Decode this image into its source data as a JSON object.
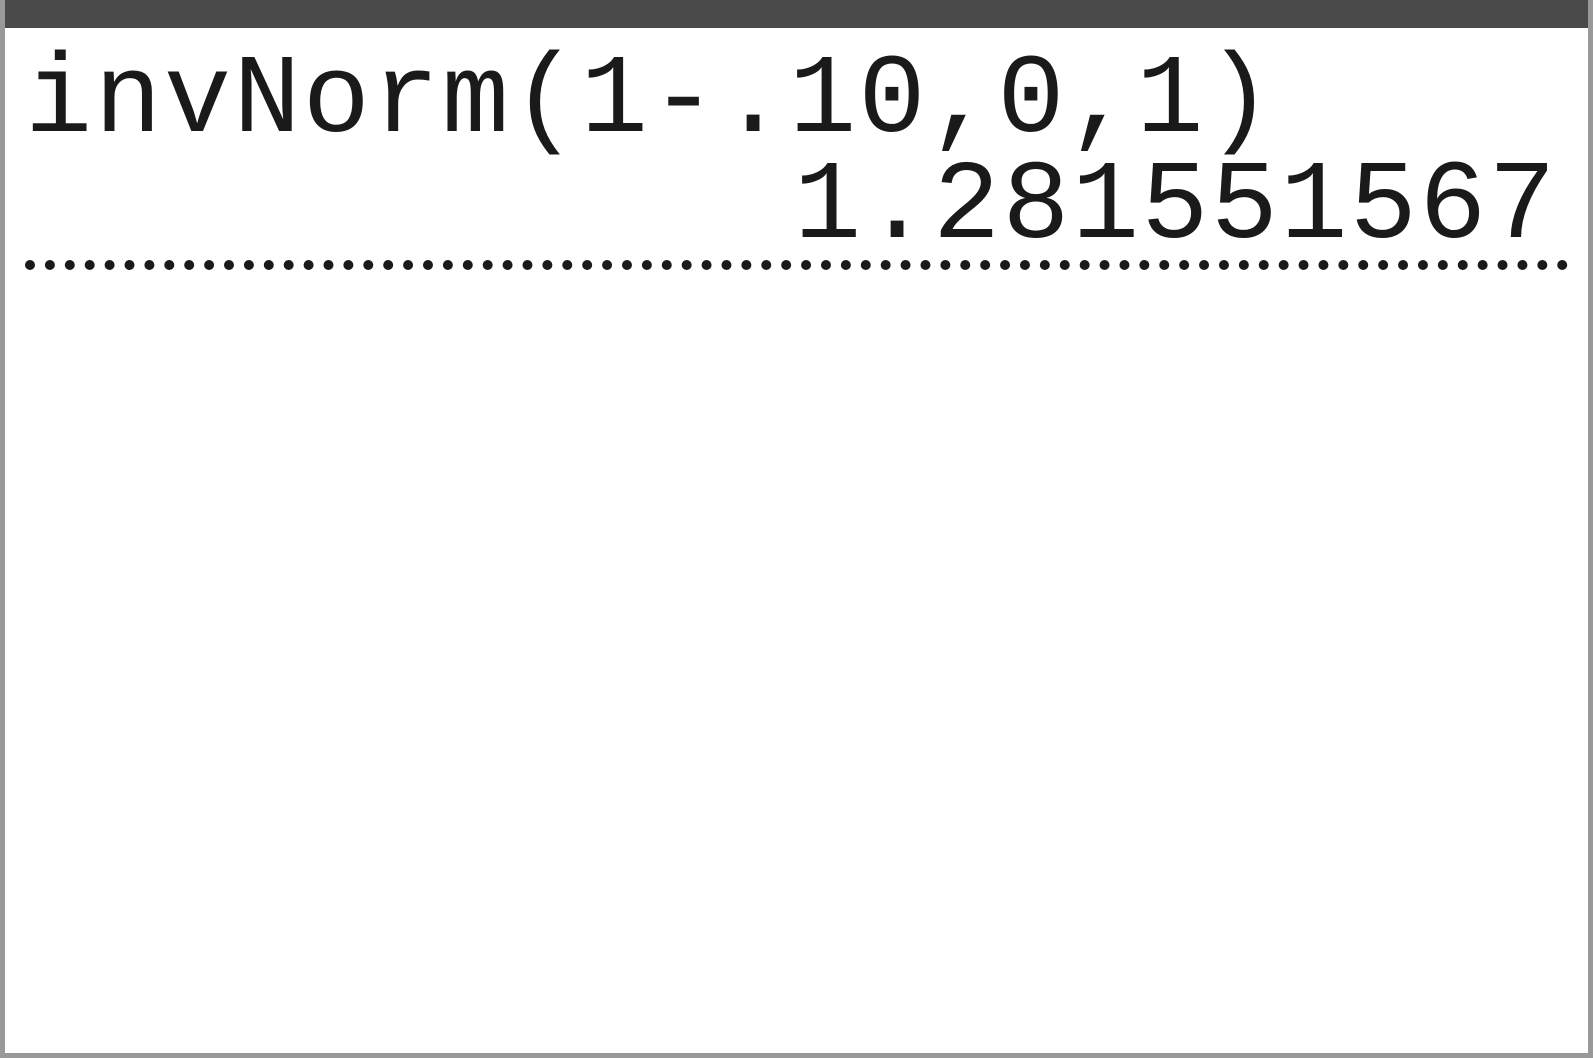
{
  "calculator": {
    "history": [
      {
        "input": "invNorm(1-.10,0,1)",
        "result": "1.281551567"
      }
    ]
  }
}
